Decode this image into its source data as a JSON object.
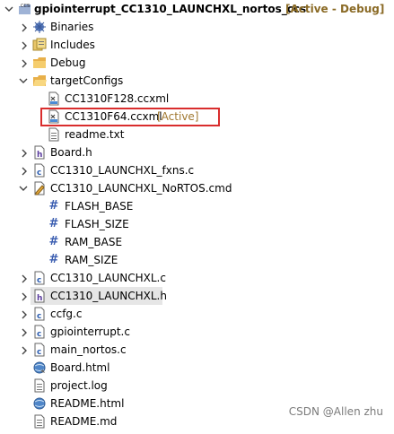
{
  "project": {
    "name": "gpiointerrupt_CC1310_LAUNCHXL_nortos_ccs",
    "status": "[Active - Debug]",
    "badge": "CCS"
  },
  "tree": {
    "binaries": "Binaries",
    "includes": "Includes",
    "debug": "Debug",
    "targetConfigs": "targetConfigs",
    "cfg1": "CC1310F128.ccxml",
    "cfg2": "CC1310F64.ccxml",
    "cfg2_tag": "[Active]",
    "readme_txt": "readme.txt",
    "board_h": "Board.h",
    "fxns_c": "CC1310_LAUNCHXL_fxns.c",
    "cmd": "CC1310_LAUNCHXL_NoRTOS.cmd",
    "sym1": "FLASH_BASE",
    "sym2": "FLASH_SIZE",
    "sym3": "RAM_BASE",
    "sym4": "RAM_SIZE",
    "launch_c": "CC1310_LAUNCHXL.c",
    "launch_h": "CC1310_LAUNCHXL.h",
    "ccfg_c": "ccfg.c",
    "gpio_c": "gpiointerrupt.c",
    "main_c": "main_nortos.c",
    "board_html": "Board.html",
    "project_log": "project.log",
    "readme_html": "README.html",
    "readme_md": "README.md"
  },
  "watermark": "CSDN @Allen  zhu"
}
